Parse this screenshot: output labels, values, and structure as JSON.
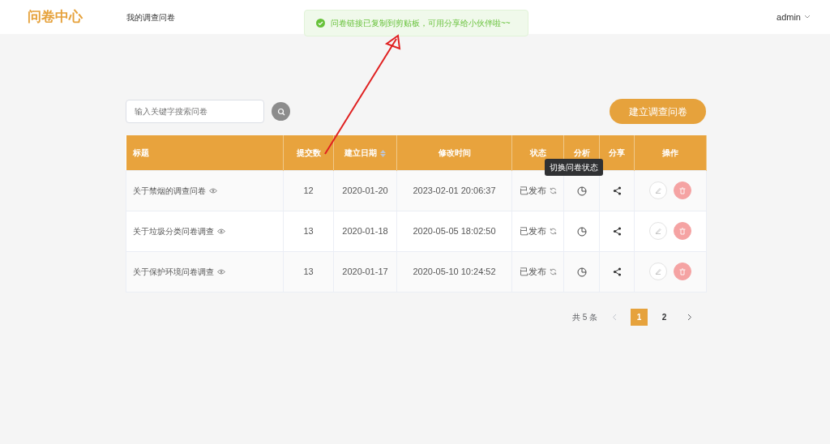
{
  "app": {
    "title": "问卷中心",
    "nav": [
      {
        "label": "我的调查问卷"
      }
    ],
    "user": "admin"
  },
  "toast": {
    "message": "问卷链接已复制到剪贴板，可用分享给小伙伴啦~~"
  },
  "search": {
    "placeholder": "输入关键字搜索问卷"
  },
  "create_button": "建立调查问卷",
  "table": {
    "columns": [
      {
        "label": "标题",
        "sortable": false
      },
      {
        "label": "提交数",
        "sortable": false
      },
      {
        "label": "建立日期",
        "sortable": true
      },
      {
        "label": "修改时间",
        "sortable": false
      },
      {
        "label": "状态",
        "sortable": false
      },
      {
        "label": "分析",
        "sortable": false
      },
      {
        "label": "分享",
        "sortable": false
      },
      {
        "label": "操作",
        "sortable": false
      }
    ],
    "rows": [
      {
        "title": "关于禁烟的调查问卷",
        "submissions": "12",
        "created": "2020-01-20",
        "modified": "2023-02-01 20:06:37",
        "status": "已发布"
      },
      {
        "title": "关于垃圾分类问卷调查",
        "submissions": "13",
        "created": "2020-01-18",
        "modified": "2020-05-05 18:02:50",
        "status": "已发布"
      },
      {
        "title": "关于保护环境问卷调查",
        "submissions": "13",
        "created": "2020-01-17",
        "modified": "2020-05-10 10:24:52",
        "status": "已发布"
      }
    ]
  },
  "tooltip": "切换问卷状态",
  "pagination": {
    "total": "共 5 条",
    "pages": [
      {
        "label": "1",
        "selected": true
      },
      {
        "label": "2",
        "selected": false
      }
    ]
  }
}
